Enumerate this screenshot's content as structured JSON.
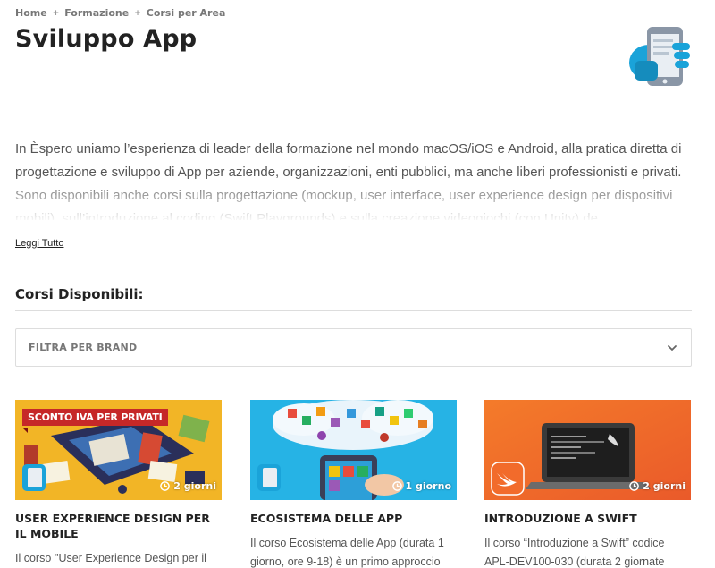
{
  "breadcrumb": {
    "home": "Home",
    "formazione": "Formazione",
    "area": "Corsi per Area",
    "separator": "+"
  },
  "page": {
    "title": "Sviluppo App"
  },
  "header_icon": "mobile-app-icon",
  "intro": {
    "text": "In Èspero uniamo l’esperienza di leader della formazione nel mondo macOS/iOS e Android, alla pratica diretta di progettazione e sviluppo di App per aziende, organizzazioni, enti pubblici, ma anche liberi professionisti e privati. Sono disponibili anche corsi sulla progettazione (mockup, user interface, user experience design per dispositivi mobili), sull’introduzione al coding (Swift Playgrounds) e sulla creazione videogiochi (con Unity) de…"
  },
  "read_more": "Leggi Tutto",
  "section": {
    "title": "Corsi Disponibili:"
  },
  "filter": {
    "label": "FILTRA PER BRAND"
  },
  "courses": [
    {
      "badge": "SCONTO IVA PER PRIVATI",
      "duration": "2 giorni",
      "title": "USER EXPERIENCE DESIGN PER IL MOBILE",
      "description": "Il corso ''User Experience Design per il"
    },
    {
      "duration": "1 giorno",
      "title": "ECOSISTEMA DELLE APP",
      "description": "Il corso Ecosistema delle App (durata 1 giorno, ore 9-18) è un primo approccio"
    },
    {
      "duration": "2 giorni",
      "title": "INTRODUZIONE A SWIFT",
      "description": "Il corso “Introduzione a Swift” codice APL-DEV100-030 (durata 2 giornate"
    }
  ],
  "colors": {
    "accent_blue": "#1aa3d9",
    "badge_red": "#c62828",
    "swift_orange": "#f06a2c"
  }
}
